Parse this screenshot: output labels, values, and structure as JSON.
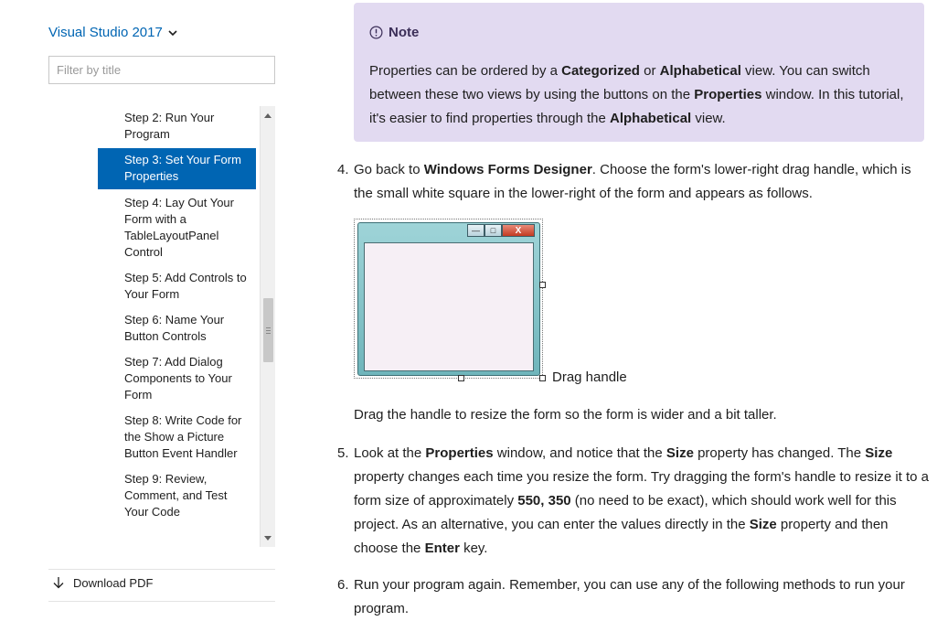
{
  "sidebar": {
    "version": "Visual Studio 2017",
    "filter_placeholder": "Filter by title",
    "toc_items": [
      {
        "label": "Step 2: Run Your Program"
      },
      {
        "label": "Step 3: Set Your Form Properties"
      },
      {
        "label": "Step 4: Lay Out Your Form with a TableLayoutPanel Control"
      },
      {
        "label": "Step 5: Add Controls to Your Form"
      },
      {
        "label": "Step 6: Name Your Button Controls"
      },
      {
        "label": "Step 7: Add Dialog Components to Your Form"
      },
      {
        "label": "Step 8: Write Code for the Show a Picture Button Event Handler"
      },
      {
        "label": "Step 9: Review, Comment, and Test Your Code"
      }
    ],
    "active_index": 1,
    "download_label": "Download PDF"
  },
  "note": {
    "heading": "Note",
    "parts": [
      "Properties can be ordered by a ",
      "Categorized",
      " or ",
      "Alphabetical",
      " view. You can switch between these two views by using the buttons on the ",
      "Properties",
      " window. In this tutorial, it's easier to find properties through the ",
      "Alphabetical",
      " view."
    ]
  },
  "steps": {
    "s4": {
      "num": "4.",
      "parts": [
        "Go back to ",
        "Windows Forms Designer",
        ". Choose the form's lower-right drag handle, which is the small white square in the lower-right of the form and appears as follows."
      ],
      "drag_label": "Drag handle",
      "after": "Drag the handle to resize the form so the form is wider and a bit taller."
    },
    "s5": {
      "num": "5.",
      "parts": [
        "Look at the ",
        "Properties",
        " window, and notice that the ",
        "Size",
        " property has changed. The ",
        "Size",
        " property changes each time you resize the form. Try dragging the form's handle to resize it to a form size of approximately ",
        "550, 350",
        " (no need to be exact), which should work well for this project. As an alternative, you can enter the values directly in the ",
        "Size",
        " property and then choose the ",
        "Enter",
        " key."
      ]
    },
    "s6": {
      "num": "6.",
      "text": "Run your program again. Remember, you can use any of the following methods to run your program."
    }
  },
  "colors": {
    "accent": "#0065b3",
    "note_bg": "#e2daf1"
  }
}
